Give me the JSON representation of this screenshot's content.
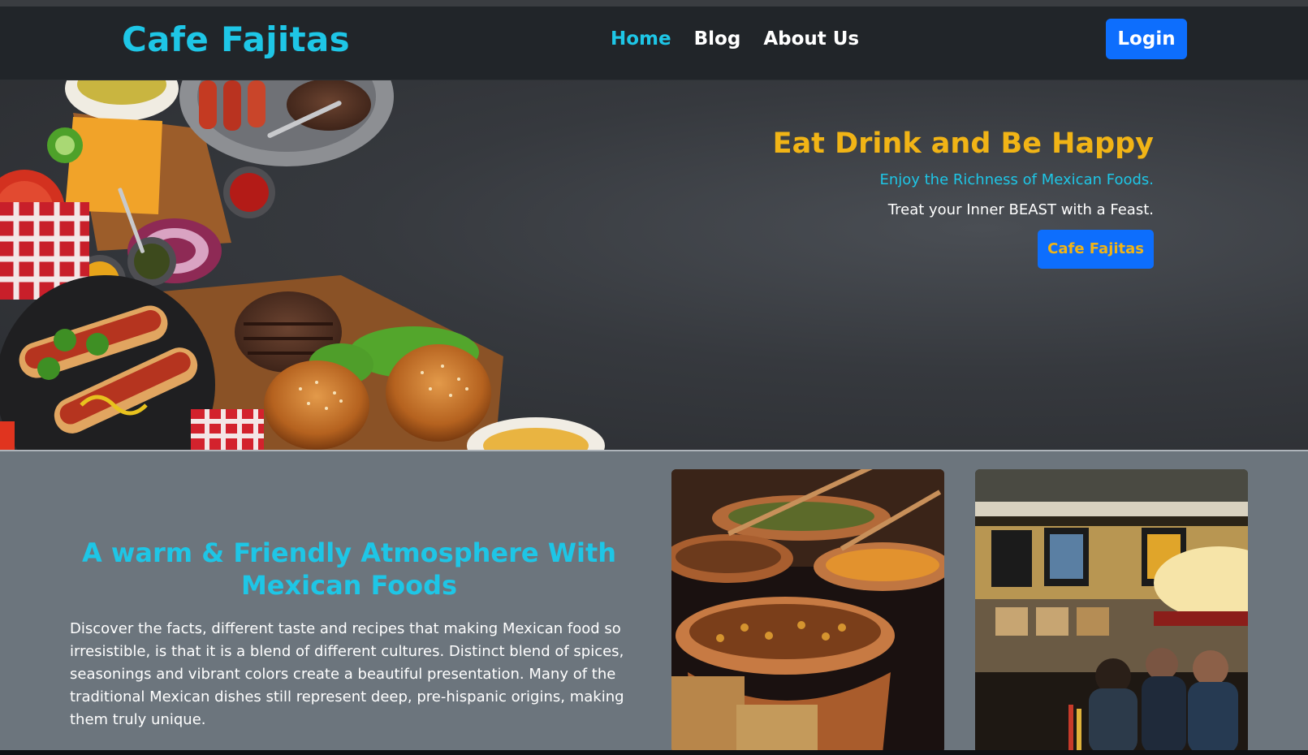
{
  "navbar": {
    "brand": "Cafe Fajitas",
    "links": [
      {
        "label": "Home",
        "active": true
      },
      {
        "label": "Blog",
        "active": false
      },
      {
        "label": "About Us",
        "active": false
      }
    ],
    "login_label": "Login"
  },
  "hero": {
    "title": "Eat Drink and Be Happy",
    "subtitle": "Enjoy the Richness of Mexican Foods.",
    "tagline": "Treat your Inner BEAST with a Feast.",
    "button_label": "Cafe Fajitas"
  },
  "about": {
    "title": "A warm & Friendly Atmosphere With Mexican Foods",
    "body": "Discover the facts, different taste and recipes that making Mexican food so irresistible, is that it is a blend of different cultures. Distinct blend of spices, seasonings and vibrant colors create a beautiful presentation. Many of the traditional Mexican dishes still represent deep, pre-hispanic origins, making them truly unique."
  },
  "colors": {
    "navbar_bg": "#212529",
    "brand": "#1ec6e6",
    "accent_yellow": "#f1b416",
    "button_blue": "#0d6efd",
    "section_bg": "#6c757d"
  }
}
